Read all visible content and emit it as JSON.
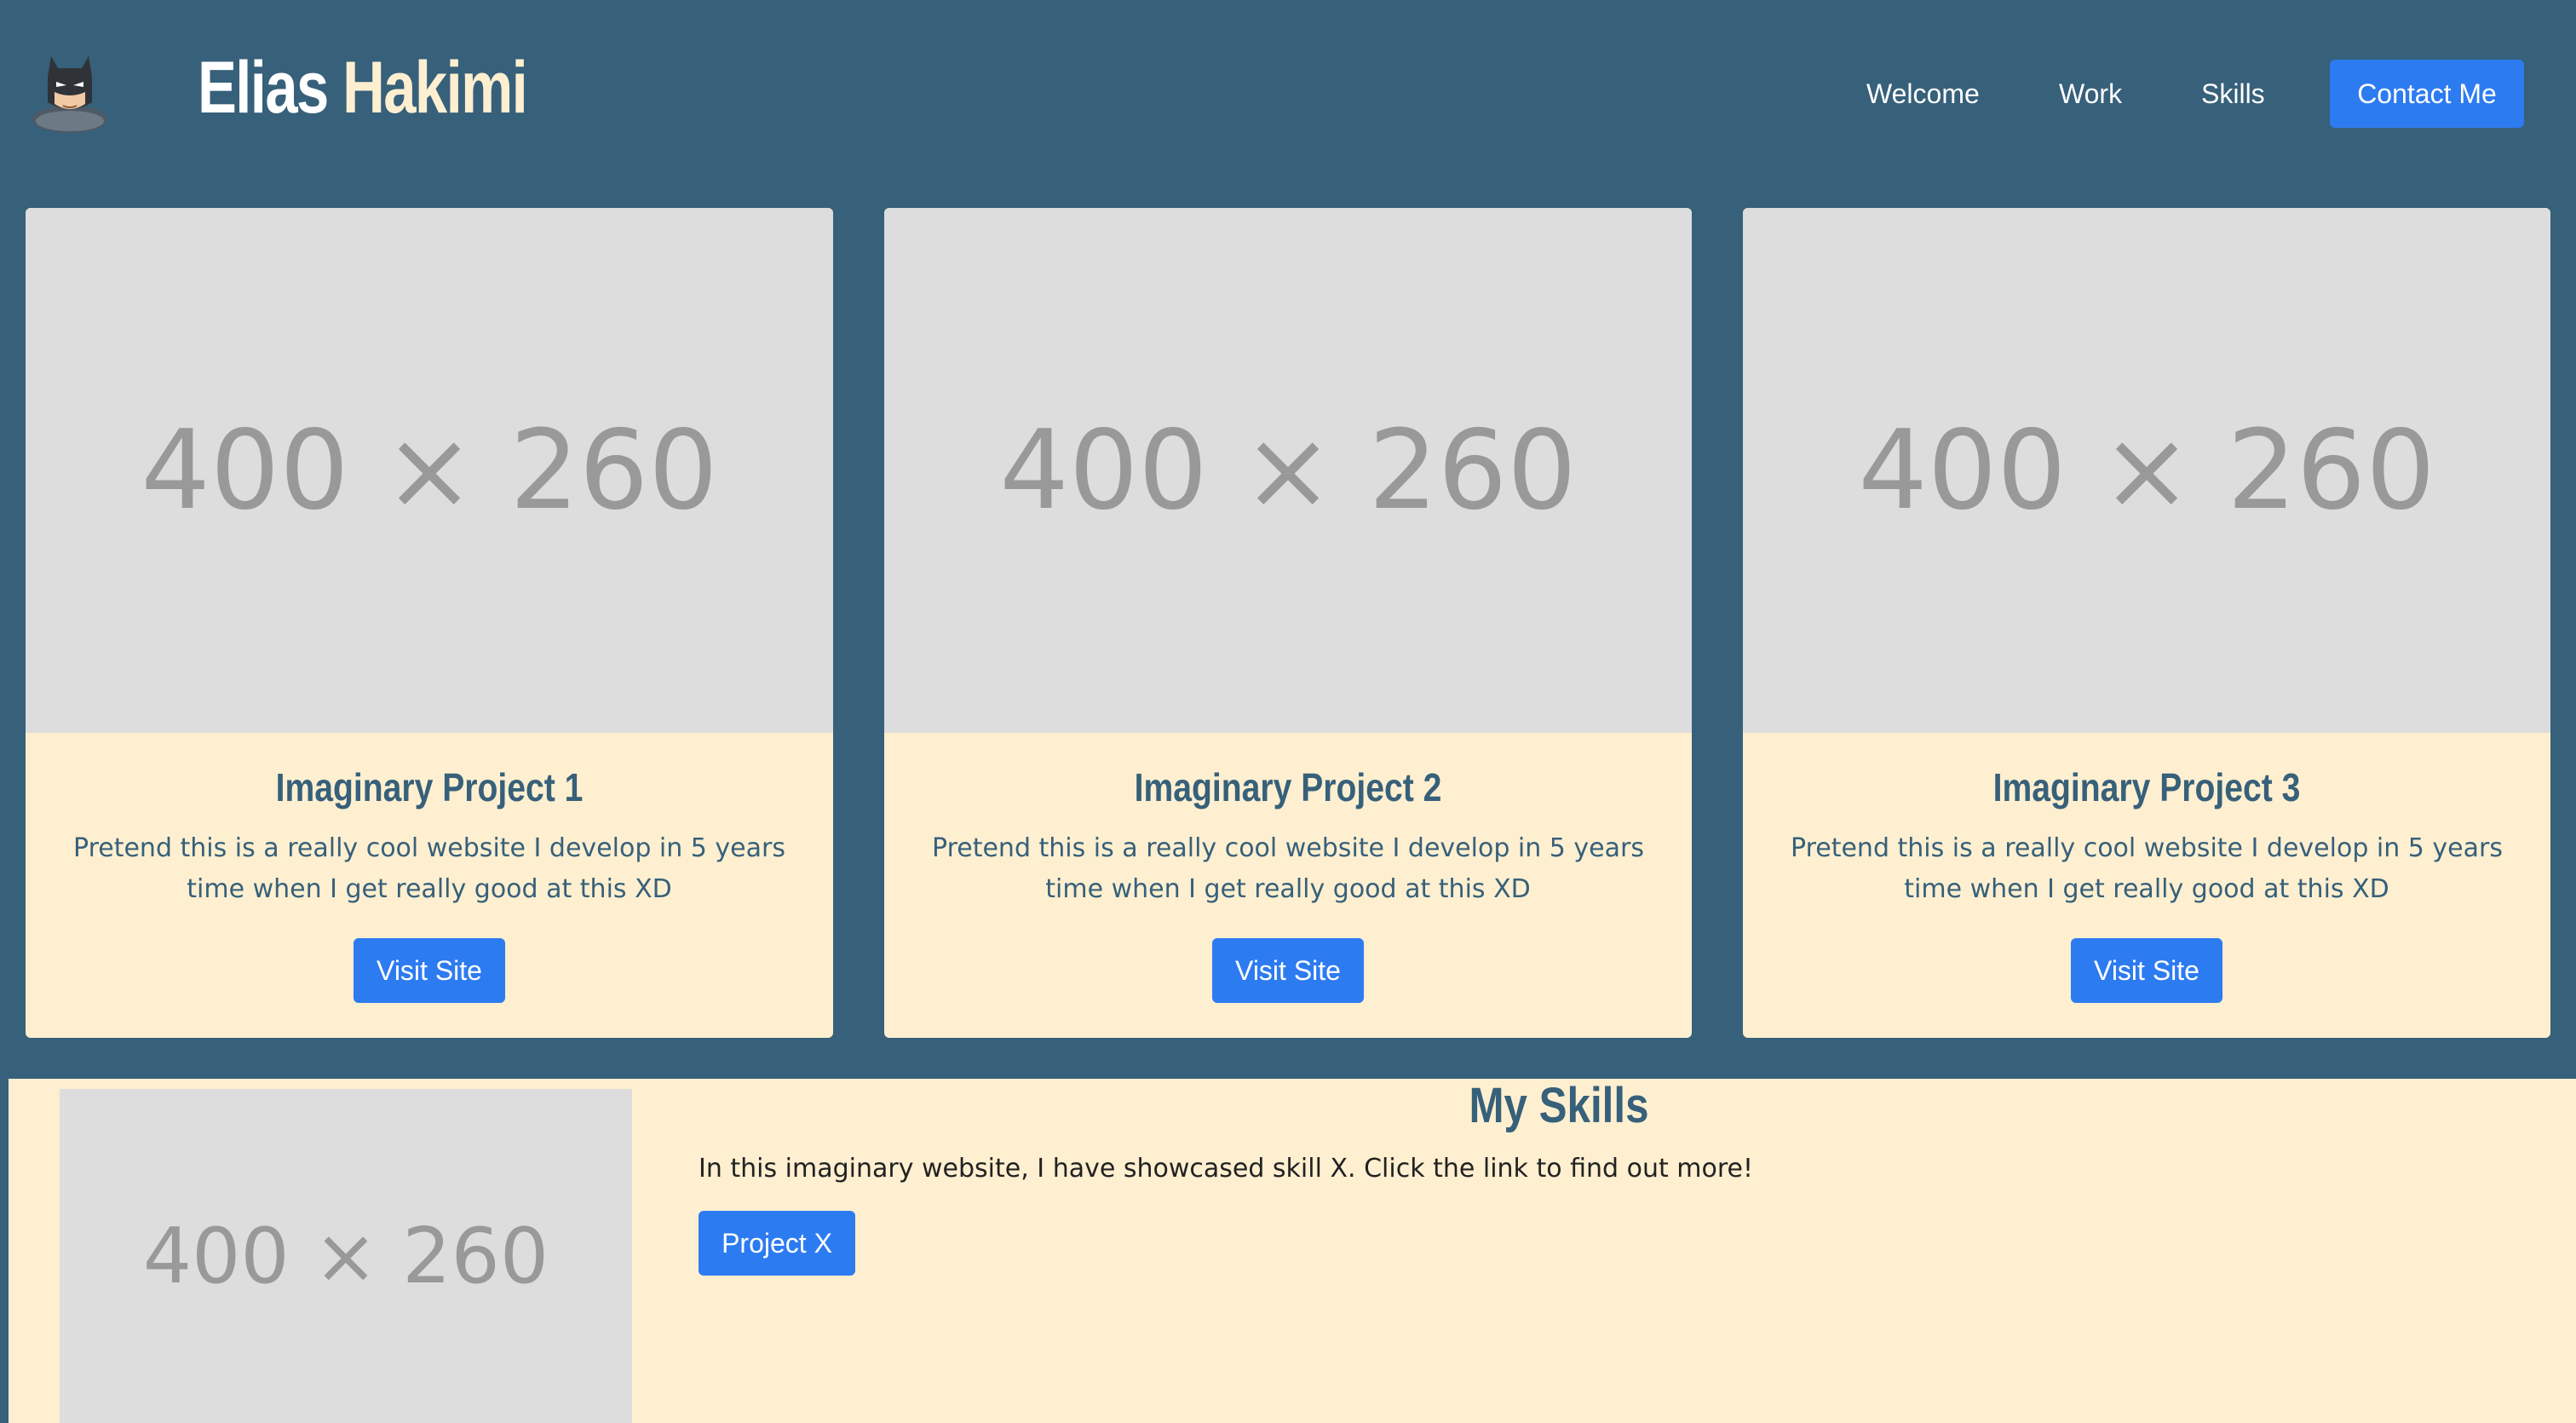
{
  "colors": {
    "background": "#37607a",
    "cream": "#fdefd0",
    "accent_blue": "#2d7bf1",
    "placeholder_bg": "#dddddd",
    "placeholder_text": "#999999"
  },
  "header": {
    "logo_icon": "masked-hero-avatar-icon",
    "brand_first": "Elias",
    "brand_last": "Hakimi",
    "nav": {
      "welcome": "Welcome",
      "work": "Work",
      "skills": "Skills",
      "contact": "Contact Me"
    }
  },
  "projects": [
    {
      "image_text": "400 × 260",
      "title": "Imaginary Project 1",
      "description": "Pretend this is a really cool website I develop in 5 years time when I get really good at this XD",
      "button": "Visit Site"
    },
    {
      "image_text": "400 × 260",
      "title": "Imaginary Project 2",
      "description": "Pretend this is a really cool website I develop in 5 years time when I get really good at this XD",
      "button": "Visit Site"
    },
    {
      "image_text": "400 × 260",
      "title": "Imaginary Project 3",
      "description": "Pretend this is a really cool website I develop in 5 years time when I get really good at this XD",
      "button": "Visit Site"
    }
  ],
  "skills": {
    "title": "My Skills",
    "image_text": "400 × 260",
    "description": "In this imaginary website, I have showcased skill X. Click the link to find out more!",
    "button": "Project X"
  }
}
